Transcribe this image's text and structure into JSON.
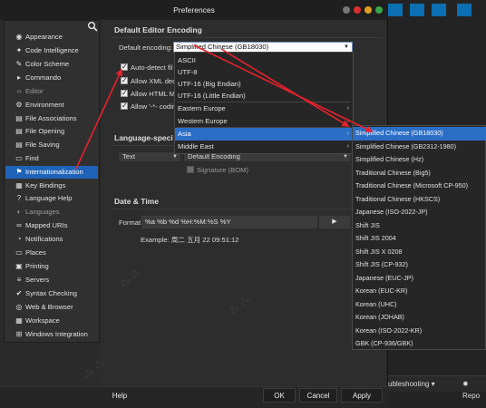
{
  "window": {
    "title": "Preferences"
  },
  "sidebar": {
    "items": [
      {
        "label": "Appearance",
        "icon": "palette-icon",
        "glyph": "◉",
        "state": "normal"
      },
      {
        "label": "Code Intelligence",
        "icon": "bulb-icon",
        "glyph": "✦",
        "state": "normal"
      },
      {
        "label": "Color Scheme",
        "icon": "brush-icon",
        "glyph": "✎",
        "state": "normal"
      },
      {
        "label": "Commando",
        "icon": "terminal-icon",
        "glyph": "▸",
        "state": "normal"
      },
      {
        "label": "Editor",
        "icon": "code-icon",
        "glyph": "‹›",
        "state": "dim"
      },
      {
        "label": "Environment",
        "icon": "gear-icon",
        "glyph": "⚙",
        "state": "normal"
      },
      {
        "label": "File Associations",
        "icon": "file-link-icon",
        "glyph": "▤",
        "state": "normal"
      },
      {
        "label": "File Opening",
        "icon": "file-open-icon",
        "glyph": "▤",
        "state": "normal"
      },
      {
        "label": "File Saving",
        "icon": "file-save-icon",
        "glyph": "▤",
        "state": "normal"
      },
      {
        "label": "Find",
        "icon": "folder-icon",
        "glyph": "▭",
        "state": "normal"
      },
      {
        "label": "Internationalization",
        "icon": "flag-icon",
        "glyph": "⚑",
        "state": "active"
      },
      {
        "label": "Key Bindings",
        "icon": "keyboard-icon",
        "glyph": "▦",
        "state": "normal"
      },
      {
        "label": "Language Help",
        "icon": "help-icon",
        "glyph": "?",
        "state": "normal"
      },
      {
        "label": "Languages",
        "icon": "languages-icon",
        "glyph": "◐",
        "state": "dim"
      },
      {
        "label": "Mapped URIs",
        "icon": "link-icon",
        "glyph": "∞",
        "state": "normal"
      },
      {
        "label": "Notifications",
        "icon": "bell-icon",
        "glyph": "◔",
        "state": "normal"
      },
      {
        "label": "Places",
        "icon": "places-icon",
        "glyph": "▭",
        "state": "normal"
      },
      {
        "label": "Printing",
        "icon": "printer-icon",
        "glyph": "▣",
        "state": "normal"
      },
      {
        "label": "Servers",
        "icon": "server-icon",
        "glyph": "≡",
        "state": "normal"
      },
      {
        "label": "Syntax Checking",
        "icon": "check-icon",
        "glyph": "✔",
        "state": "normal"
      },
      {
        "label": "Web & Browser",
        "icon": "globe-icon",
        "glyph": "◎",
        "state": "normal"
      },
      {
        "label": "Workspace",
        "icon": "workspace-icon",
        "glyph": "▦",
        "state": "normal"
      },
      {
        "label": "Windows Integration",
        "icon": "windows-icon",
        "glyph": "⊞",
        "state": "normal"
      }
    ]
  },
  "editor_encoding": {
    "heading": "Default Editor Encoding",
    "default_label": "Default encoding:",
    "selected": "Simplified Chinese (GB18030)",
    "options": [
      {
        "label": "Auto-detect fil",
        "checked": true
      },
      {
        "label": "Allow XML dec",
        "checked": true
      },
      {
        "label": "Allow HTML M",
        "checked": true
      },
      {
        "label": "Allow '-*- coding:",
        "checked": true
      }
    ]
  },
  "language_specific": {
    "heading": "Language-speci",
    "language_value": "Text",
    "encoding_value": "Default Encoding",
    "signature_label": "Signature (BOM)",
    "signature_checked": false
  },
  "date_time": {
    "heading": "Date & Time",
    "format_label": "Format",
    "format_value": "%a %b %d %H:%M:%S %Y",
    "example_label": "Example:",
    "example_value": "周二 五月 22 09:51:12"
  },
  "encoding_menu": {
    "items": [
      {
        "label": "ASCII",
        "submenu": false
      },
      {
        "label": "UTF-8",
        "submenu": false
      },
      {
        "label": "UTF-16 (Big Endian)",
        "submenu": false
      },
      {
        "label": "UTF-16 (Little Endian)",
        "submenu": false
      },
      {
        "label": "Eastern Europe",
        "submenu": true
      },
      {
        "label": "Western Europe",
        "submenu": true
      },
      {
        "label": "Asia",
        "submenu": true,
        "highlighted": true
      },
      {
        "label": "Middle East",
        "submenu": true
      }
    ]
  },
  "asia_submenu": {
    "items": [
      {
        "label": "Simplified Chinese (GB18030)",
        "highlighted": true
      },
      {
        "label": "Simplified Chinese (GB2312-1980)"
      },
      {
        "label": "Simplified Chinese (Hz)"
      },
      {
        "label": "Traditional Chinese (Big5)"
      },
      {
        "label": "Traditional Chinese (Microsoft CP-950)"
      },
      {
        "label": "Traditional Chinese (HKSCS)"
      },
      {
        "label": "Japanese (ISO-2022-JP)"
      },
      {
        "label": "Shift JIS"
      },
      {
        "label": "Shift JIS 2004"
      },
      {
        "label": "Shift JIS X 0208"
      },
      {
        "label": "Shift JIS (CP-932)"
      },
      {
        "label": "Japanese (EUC-JP)"
      },
      {
        "label": "Korean (EUC-KR)"
      },
      {
        "label": "Korean (UHC)"
      },
      {
        "label": "Korean (JOHAB)"
      },
      {
        "label": "Korean (ISO-2022-KR)"
      },
      {
        "label": "GBK (CP-936/GBK)"
      }
    ]
  },
  "footer": {
    "help": "Help",
    "ok": "OK",
    "cancel": "Cancel",
    "apply": "Apply"
  },
  "background_app": {
    "troubleshooting": "ubleshooting",
    "report": "Repo"
  },
  "colors": {
    "accent": "#1f63b8",
    "highlight": "#2b6ec6",
    "annotation": "#e8212d",
    "traffic_close": "#d9302f",
    "traffic_min": "#e0a020",
    "traffic_max": "#3aa845"
  }
}
